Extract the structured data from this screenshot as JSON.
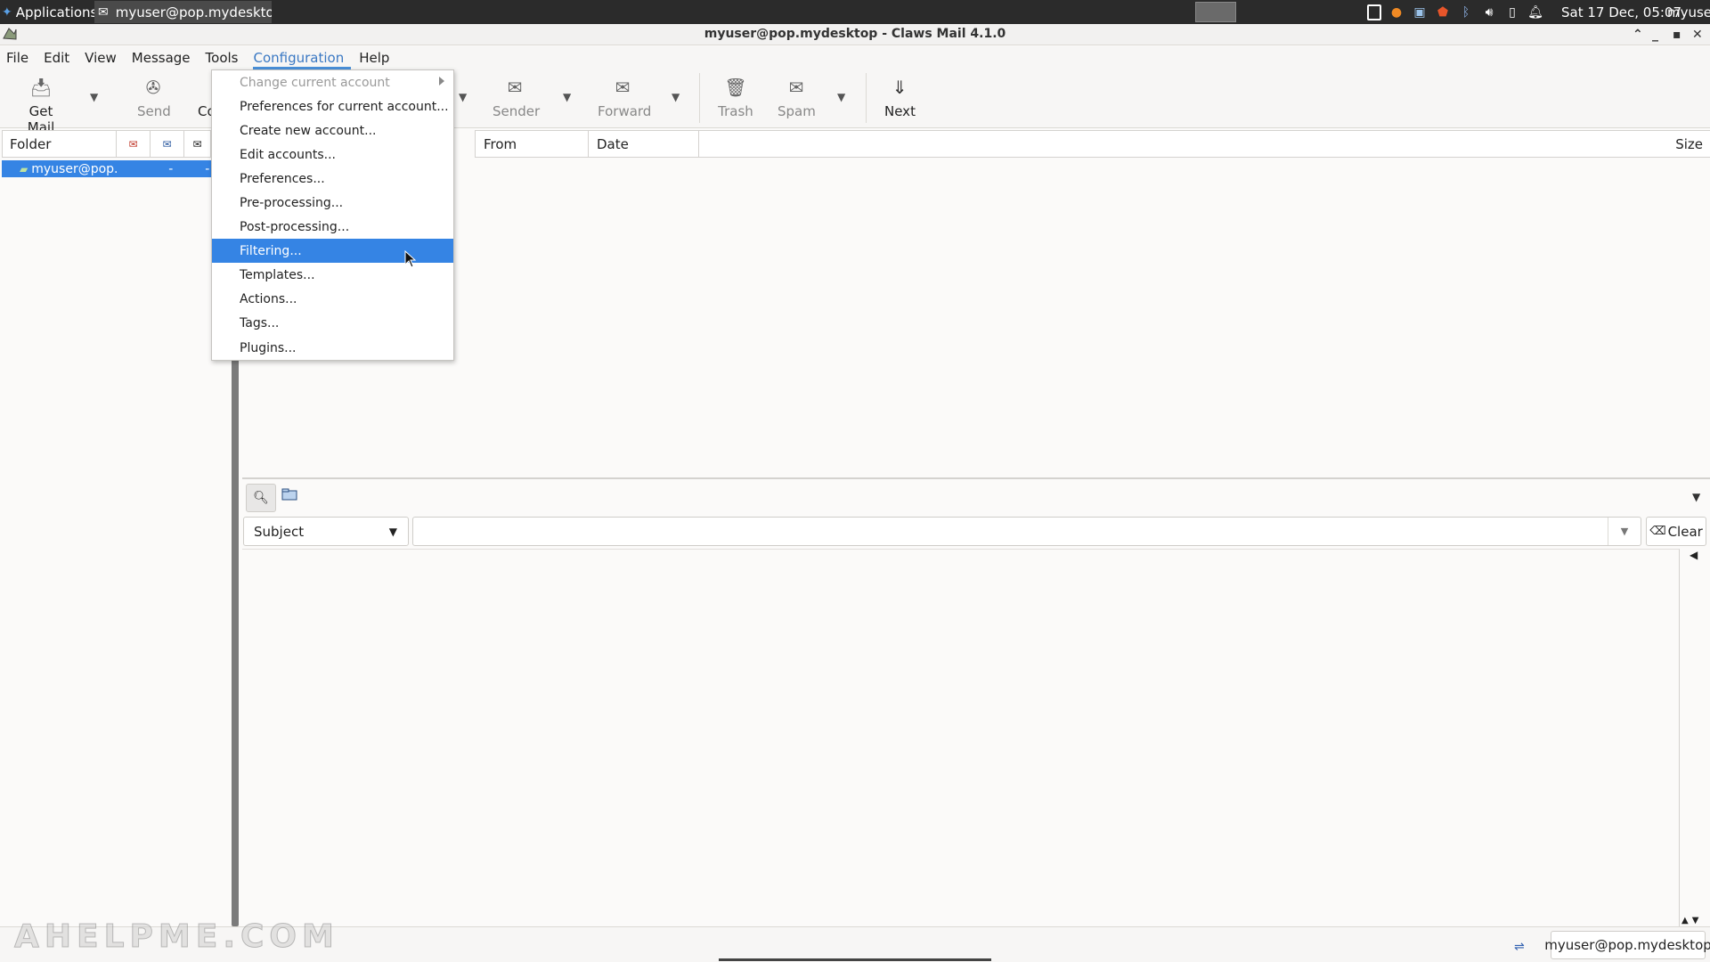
{
  "panel": {
    "applications_label": "Applications",
    "task_label": "myuser@pop.mydesktop ...",
    "clock": "Sat 17 Dec, 05:07",
    "user": "myuser"
  },
  "window": {
    "title": "myuser@pop.mydesktop - Claws Mail 4.1.0"
  },
  "menubar": {
    "items": [
      "File",
      "Edit",
      "View",
      "Message",
      "Tools",
      "Configuration",
      "Help"
    ],
    "active": "Configuration"
  },
  "toolbar": {
    "get_mail": "Get Mail",
    "send": "Send",
    "compose": "Co",
    "sender": "Sender",
    "forward": "Forward",
    "trash": "Trash",
    "spam": "Spam",
    "next": "Next"
  },
  "folder_pane": {
    "header": "Folder",
    "rows": [
      {
        "name": "myuser@pop.",
        "unread": "-",
        "total": "-"
      }
    ]
  },
  "message_list": {
    "columns": [
      "From",
      "Date",
      "Size"
    ]
  },
  "quick_search": {
    "type_selected": "Subject",
    "value": "",
    "clear_label": "Clear"
  },
  "statusbar": {
    "account": "myuser@pop.mydesktop"
  },
  "watermark": "AHELPME.COM",
  "dropdown": {
    "items": [
      {
        "label": "Change current account",
        "disabled": true,
        "submenu": true
      },
      {
        "label": "Preferences for current account...",
        "disabled": false,
        "submenu": false
      },
      {
        "label": "Create new account...",
        "disabled": false,
        "submenu": false
      },
      {
        "label": "Edit accounts...",
        "disabled": false,
        "submenu": false
      },
      {
        "label": "Preferences...",
        "disabled": false,
        "submenu": false
      },
      {
        "label": "Pre-processing...",
        "disabled": false,
        "submenu": false
      },
      {
        "label": "Post-processing...",
        "disabled": false,
        "submenu": false
      },
      {
        "label": "Filtering...",
        "disabled": false,
        "submenu": false,
        "highlighted": true
      },
      {
        "label": "Templates...",
        "disabled": false,
        "submenu": false
      },
      {
        "label": "Actions...",
        "disabled": false,
        "submenu": false
      },
      {
        "label": "Tags...",
        "disabled": false,
        "submenu": false
      },
      {
        "label": "Plugins...",
        "disabled": false,
        "submenu": false
      }
    ]
  },
  "colors": {
    "selection": "#3584e4",
    "panel_bg": "#2b2b2b",
    "menu_active": "#3a78c3"
  }
}
